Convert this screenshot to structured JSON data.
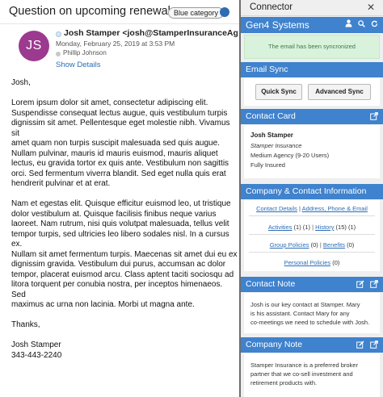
{
  "email": {
    "subject": "Question on upcoming renewal",
    "category": {
      "label": "Blue category",
      "color": "#2e6db3"
    },
    "avatar_initials": "JS",
    "avatar_color": "#9b3a8f",
    "sender": "Josh Stamper <josh@StamperInsuranceAge...",
    "sent_date": "Monday, February 25, 2019 at 3:53 PM",
    "to": "Phillip Johnson",
    "show_details": "Show Details",
    "body": {
      "greeting": "Josh,",
      "para1": "Lorem ipsum dolor sit amet, consectetur adipiscing elit.\nSuspendisse consequat lectus augue, quis vestibulum turpis\ndignissim sit amet. Pellentesque eget molestie nibh. Vivamus sit\namet quam non turpis suscipit malesuada sed quis augue.\nNullam pulvinar, mauris id mauris euismod, mauris aliquet\nlectus, eu gravida tortor ex quis ante. Vestibulum non sagittis\norci. Sed fermentum viverra blandit. Sed eget nulla quis erat\nhendrerit pulvinar et at erat.",
      "para2": "Nam et egestas elit. Quisque efficitur euismod leo, ut tristique\ndolor vestibulum at. Quisque facilisis finibus neque varius\nlaoreet. Nam rutrum, nisi quis volutpat malesuada, tellus velit\ntempor turpis, sed ultricies leo libero sodales nisl. In a cursus ex.\nNullam sit amet fermentum turpis. Maecenas sit amet dui eu ex\ndignissim gravida. Vestibulum dui purus, accumsan ac dolor\ntempor, placerat euismod arcu. Class aptent taciti sociosqu ad\nlitora torquent per conubia nostra, per inceptos himenaeos. Sed\nmaximus ac urna non lacinia. Morbi ut magna ante.",
      "closing": "Thanks,",
      "signature_name": "Josh Stamper",
      "signature_phone": "343-443-2240"
    }
  },
  "connector": {
    "title": "Connector",
    "close": "✕",
    "account": "Gen4 Systems",
    "success_message": "The email has been syncronized",
    "email_sync": {
      "label": "Email Sync",
      "quick_sync": "Quick Sync",
      "advanced_sync": "Advanced Sync"
    },
    "contact_card": {
      "label": "Contact Card",
      "name": "Josh Stamper",
      "company": "Stamper Insurance",
      "size": "Medium Agency (9-20 Users)",
      "status": "Fully Insured"
    },
    "company_info": {
      "label": "Company & Contact Information",
      "contact_details": "Contact Details",
      "address_phone_email": "Address, Phone & Email",
      "activities": "Activities",
      "activities_count": "(1)",
      "activities_new": "(1)",
      "history": "History",
      "history_count": "(15)",
      "history_new": "(1)",
      "group_policies": "Group Policies",
      "group_policies_count": "(0)",
      "benefits": "Benefits",
      "benefits_count": "(0)",
      "personal_policies": "Personal Policies",
      "personal_policies_count": "(0)"
    },
    "contact_note": {
      "label": "Contact Note",
      "text": "Josh is our key contact at Stamper. Mary\nis his assistant. Contact Mary for any\nco-meetings we need to schedule with Josh."
    },
    "company_note": {
      "label": "Company Note",
      "text": "Stamper Insurance is a preferred broker\npartner that we co-sell investment and\nretirement products with."
    },
    "colors": {
      "accent": "#3f82cd",
      "success_bg": "#d9f2dc",
      "link": "#2c6db5"
    }
  }
}
